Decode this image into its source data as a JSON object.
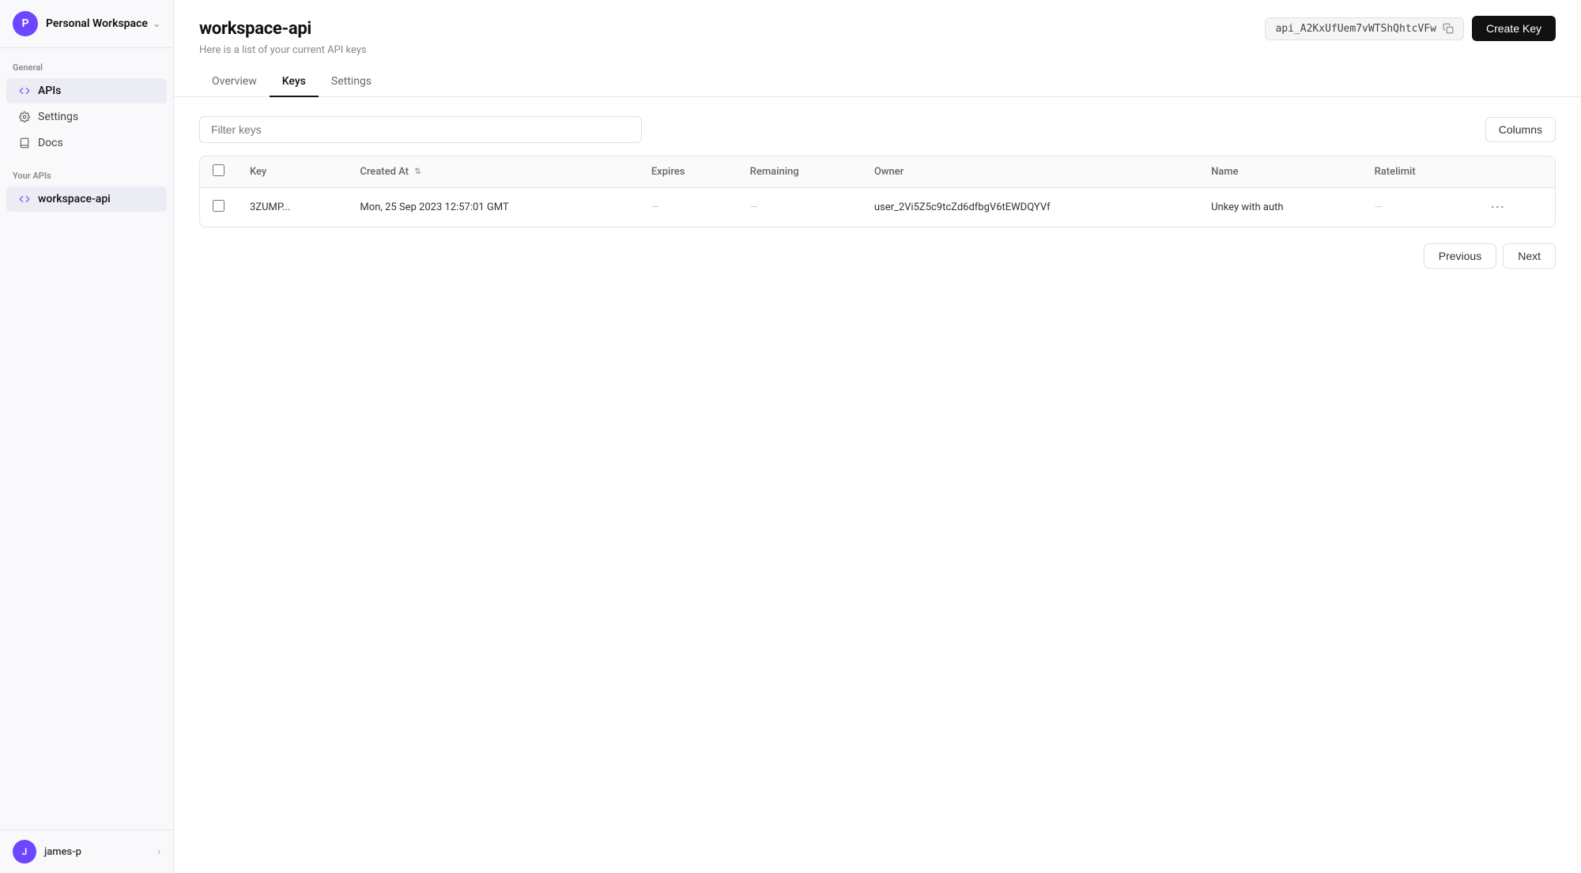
{
  "sidebar": {
    "workspace": {
      "name": "Personal Workspace",
      "avatar_letter": "P"
    },
    "general_label": "General",
    "your_apis_label": "Your APIs",
    "items_general": [
      {
        "id": "apis",
        "label": "APIs",
        "icon": "code-icon",
        "active": true
      },
      {
        "id": "settings",
        "label": "Settings",
        "icon": "settings-icon",
        "active": false
      },
      {
        "id": "docs",
        "label": "Docs",
        "icon": "book-icon",
        "active": false
      }
    ],
    "items_apis": [
      {
        "id": "workspace-api",
        "label": "workspace-api",
        "icon": "code-icon",
        "active": true
      }
    ]
  },
  "header": {
    "title": "workspace-api",
    "subtitle": "Here is a list of your current API keys",
    "api_key": "api_A2KxUfUem7vWTShQhtcVFw",
    "create_key_label": "Create Key",
    "copy_label": "Copy"
  },
  "tabs": [
    {
      "id": "overview",
      "label": "Overview",
      "active": false
    },
    {
      "id": "keys",
      "label": "Keys",
      "active": true
    },
    {
      "id": "settings",
      "label": "Settings",
      "active": false
    }
  ],
  "filter": {
    "placeholder": "Filter keys",
    "columns_label": "Columns"
  },
  "table": {
    "columns": [
      {
        "id": "key",
        "label": "Key",
        "sortable": false
      },
      {
        "id": "created_at",
        "label": "Created At",
        "sortable": true
      },
      {
        "id": "expires",
        "label": "Expires",
        "sortable": false
      },
      {
        "id": "remaining",
        "label": "Remaining",
        "sortable": false
      },
      {
        "id": "owner",
        "label": "Owner",
        "sortable": false
      },
      {
        "id": "name",
        "label": "Name",
        "sortable": false
      },
      {
        "id": "ratelimit",
        "label": "Ratelimit",
        "sortable": false
      }
    ],
    "rows": [
      {
        "key": "3ZUMP...",
        "created_at": "Mon, 25 Sep 2023 12:57:01 GMT",
        "expires": "—",
        "remaining": "—",
        "owner": "user_2Vi5Z5c9tcZd6dfbgV6tEWDQYVf",
        "name": "Unkey with auth",
        "ratelimit": "—"
      }
    ]
  },
  "pagination": {
    "previous_label": "Previous",
    "next_label": "Next"
  },
  "user": {
    "name": "james-p",
    "avatar_letter": "J"
  }
}
